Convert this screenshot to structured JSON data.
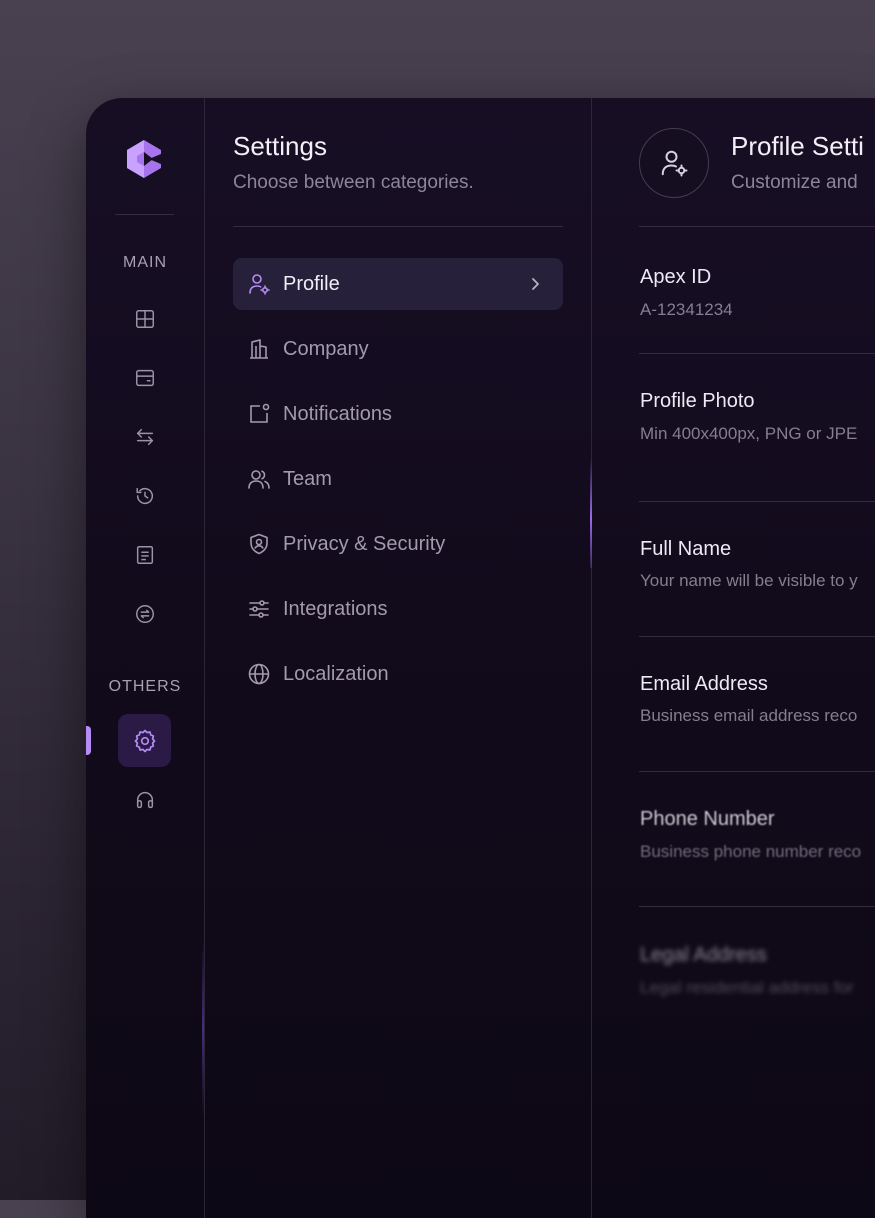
{
  "colors": {
    "accent": "#b58cf5",
    "panel_bg": "#130b1e",
    "active_item_bg": "#27203a",
    "text_primary": "#f3eff7",
    "text_secondary": "#8d8598"
  },
  "rail": {
    "logo_icon": "brand-logo-icon",
    "main_heading": "MAIN",
    "main_items": [
      {
        "icon": "grid-icon"
      },
      {
        "icon": "wallet-card-icon"
      },
      {
        "icon": "transfer-arrows-icon"
      },
      {
        "icon": "history-clock-icon"
      },
      {
        "icon": "document-icon"
      },
      {
        "icon": "exchange-circle-icon"
      }
    ],
    "others_heading": "OTHERS",
    "others_items": [
      {
        "icon": "settings-gear-icon",
        "active": true
      },
      {
        "icon": "headphones-icon",
        "active": false
      }
    ]
  },
  "categories": {
    "title": "Settings",
    "subtitle": "Choose between categories.",
    "items": [
      {
        "label": "Profile",
        "icon": "user-settings-icon",
        "active": true
      },
      {
        "label": "Company",
        "icon": "building-icon",
        "active": false
      },
      {
        "label": "Notifications",
        "icon": "notification-icon",
        "active": false
      },
      {
        "label": "Team",
        "icon": "users-icon",
        "active": false
      },
      {
        "label": "Privacy & Security",
        "icon": "shield-user-icon",
        "active": false
      },
      {
        "label": "Integrations",
        "icon": "sliders-icon",
        "active": false
      },
      {
        "label": "Localization",
        "icon": "globe-icon",
        "active": false
      }
    ]
  },
  "profile": {
    "avatar_icon": "user-settings-icon",
    "title": "Profile Setti",
    "subtitle": "Customize and",
    "fields": [
      {
        "label": "Apex ID",
        "help": "A-12341234"
      },
      {
        "label": "Profile Photo",
        "help": "Min 400x400px, PNG or JPE"
      },
      {
        "label": "Full Name",
        "help": "Your name will be visible to y"
      },
      {
        "label": "Email Address",
        "help": "Business email address reco"
      },
      {
        "label": "Phone Number",
        "help": "Business phone number reco"
      },
      {
        "label": "Legal Address",
        "help": "Legal residential address for"
      }
    ]
  }
}
